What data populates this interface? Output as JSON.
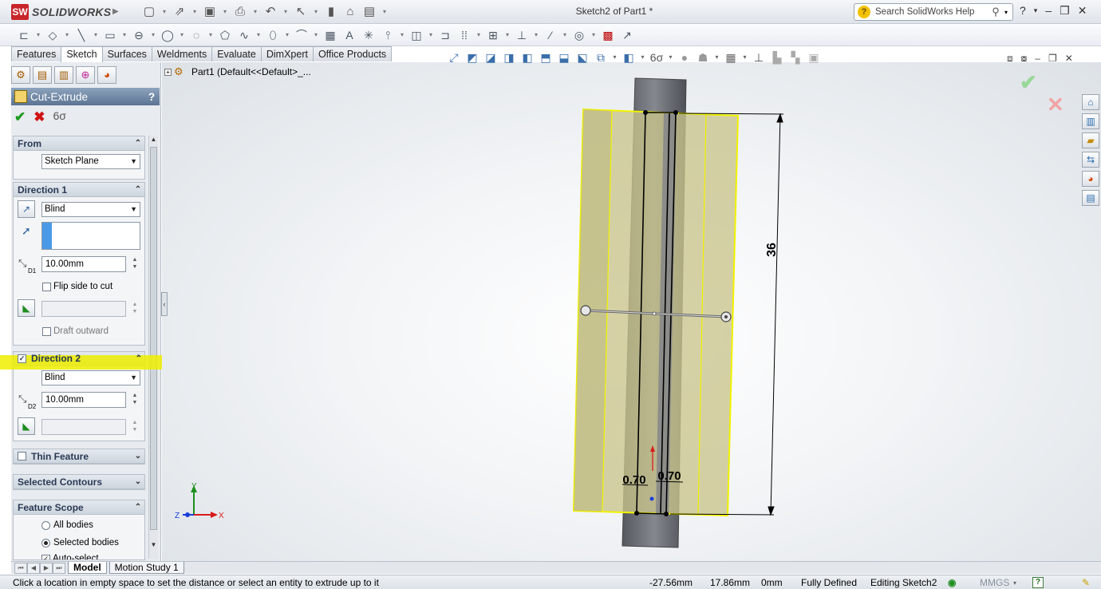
{
  "app": {
    "logo_mark": "SW",
    "logo_text": "SOLIDWORKS",
    "document_title": "Sketch2 of Part1 *",
    "search_placeholder": "Search SolidWorks Help",
    "help_glyph": "?",
    "search_icon": "magnifier-icon"
  },
  "command_tabs": [
    "Features",
    "Sketch",
    "Surfaces",
    "Weldments",
    "Evaluate",
    "DimXpert",
    "Office Products"
  ],
  "command_tabs_active": "Sketch",
  "property_manager": {
    "title": "Cut-Extrude",
    "help": "?",
    "from": {
      "label": "From",
      "value": "Sketch Plane"
    },
    "direction1": {
      "label": "Direction 1",
      "end_condition": "Blind",
      "depth_prefix": "D1",
      "depth": "10.00mm",
      "flip_side": "Flip side to cut",
      "draft_outward": "Draft outward"
    },
    "direction2": {
      "label": "Direction 2",
      "checked": true,
      "end_condition": "Blind",
      "depth_prefix": "D2",
      "depth": "10.00mm"
    },
    "thin_feature": {
      "label": "Thin Feature",
      "checked": false
    },
    "selected_contours": {
      "label": "Selected Contours"
    },
    "feature_scope": {
      "label": "Feature Scope",
      "all_bodies": "All bodies",
      "selected_bodies": "Selected bodies",
      "auto_select": "Auto-select",
      "selected": "selected_bodies"
    }
  },
  "feature_tree": {
    "root": "Part1  (Default<<Default>_..."
  },
  "model": {
    "dimension_vertical": "36",
    "dimension_left": "0.70",
    "dimension_right": "0.70",
    "colors": {
      "body_fill": "#c9c48c",
      "edge_highlight": "#f2f200",
      "cylinder": "#6f727a"
    }
  },
  "triad": {
    "x": "X",
    "y": "Y",
    "z": "Z"
  },
  "bottom_tabs": [
    "Model",
    "Motion Study 1"
  ],
  "bottom_tabs_active": "Model",
  "status": {
    "hint": "Click a location in empty space to set the distance or select an entity to extrude up to it",
    "x": "-27.56mm",
    "y": "17.86mm",
    "z": "0mm",
    "state": "Fully Defined",
    "editing": "Editing Sketch2",
    "units": "MMGS",
    "help": "?"
  }
}
